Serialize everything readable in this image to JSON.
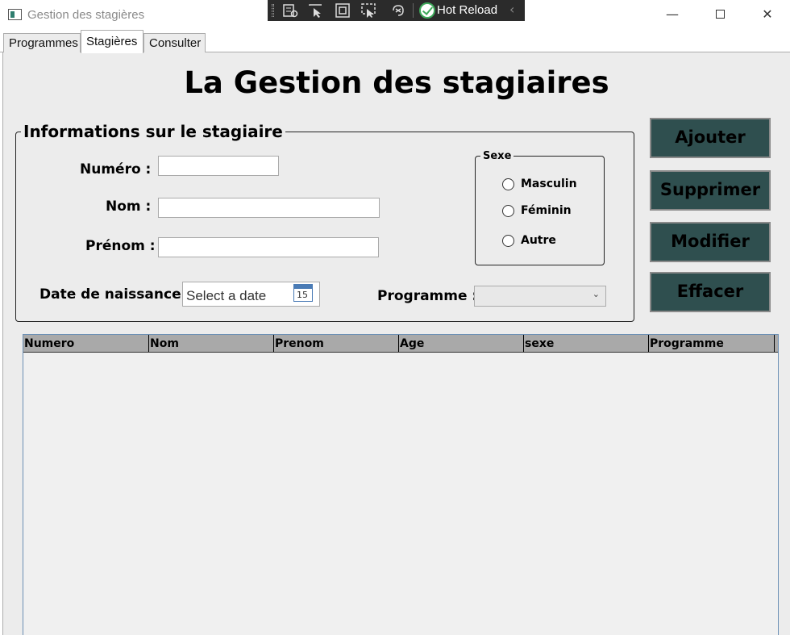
{
  "window": {
    "title": "Gestion des stagières",
    "minimize": "—",
    "close": "✕"
  },
  "debug_toolbar": {
    "hot_reload_label": "Hot Reload",
    "collapse": "‹"
  },
  "tabs": [
    {
      "label": "Programmes"
    },
    {
      "label": "Stagières"
    },
    {
      "label": "Consulter"
    }
  ],
  "page": {
    "title": "La Gestion des stagiaires"
  },
  "info_group": {
    "legend": "Informations sur le stagiaire",
    "numero_label": "Numéro :",
    "nom_label": "Nom :",
    "prenom_label": "Prénom :",
    "date_label": "Date de naissance :",
    "date_placeholder": "Select a date",
    "calendar_day": "15",
    "programme_label": "Programme :",
    "programme_value": ""
  },
  "sexe_group": {
    "legend": "Sexe",
    "options": [
      {
        "label": "Masculin"
      },
      {
        "label": "Féminin"
      },
      {
        "label": "Autre"
      }
    ]
  },
  "actions": {
    "ajouter": "Ajouter",
    "supprimer": "Supprimer",
    "modifier": "Modifier",
    "effacer": "Effacer"
  },
  "grid": {
    "columns": [
      "Numero",
      "Nom",
      "Prenom",
      "Age",
      "sexe",
      "Programme"
    ],
    "rows": []
  }
}
